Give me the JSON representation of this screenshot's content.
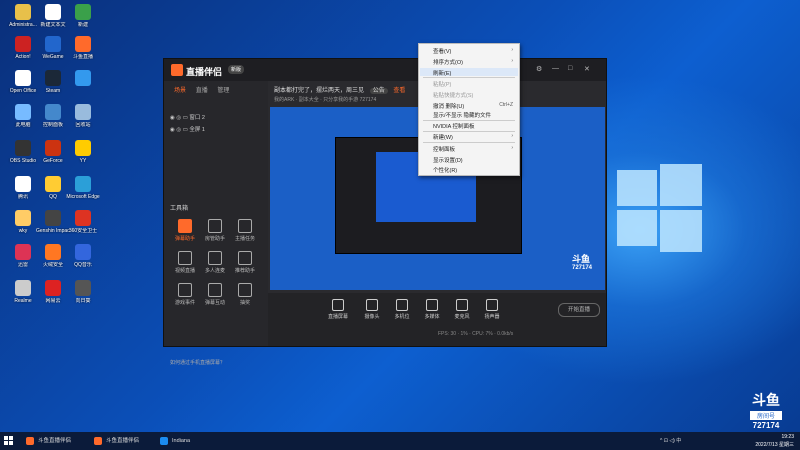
{
  "desktop_icons": [
    {
      "label": "Administra...",
      "color": "#e8c04a"
    },
    {
      "label": "新建文本文",
      "color": "#ffffff"
    },
    {
      "label": "新建",
      "color": "#3aa04a"
    },
    {
      "label": "Action!",
      "color": "#cc2222"
    },
    {
      "label": "WeGame",
      "color": "#2266cc"
    },
    {
      "label": "斗鱼直播",
      "color": "#ff6a2b"
    },
    {
      "label": "Open Office",
      "color": "#ffffff"
    },
    {
      "label": "Steam",
      "color": "#1b2838"
    },
    {
      "label": "",
      "color": "#3399ee"
    },
    {
      "label": "此电脑",
      "color": "#77bbff"
    },
    {
      "label": "控制面板",
      "color": "#4488cc"
    },
    {
      "label": "回收站",
      "color": "#99bbdd"
    },
    {
      "label": "OBS Studio",
      "color": "#333333"
    },
    {
      "label": "GeForce",
      "color": "#cc3311"
    },
    {
      "label": "YY",
      "color": "#ffcc00"
    },
    {
      "label": "腾讯",
      "color": "#ffffff"
    },
    {
      "label": "QQ",
      "color": "#ffcc33"
    },
    {
      "label": "Microsoft Edge",
      "color": "#2b9fd8"
    },
    {
      "label": "wky",
      "color": "#ffcc66"
    },
    {
      "label": "Genshin Impact",
      "color": "#444444"
    },
    {
      "label": "360安全卫士",
      "color": "#dd3322"
    },
    {
      "label": "迅雷",
      "color": "#dd3355"
    },
    {
      "label": "火绒安全",
      "color": "#ff7722"
    },
    {
      "label": "QQ音乐",
      "color": "#3366dd"
    },
    {
      "label": "Realme",
      "color": "#cccccc"
    },
    {
      "label": "网易云",
      "color": "#dd2222"
    },
    {
      "label": "向日葵",
      "color": "#555555"
    }
  ],
  "app": {
    "name": "直播伴侣",
    "version": "新版",
    "win_controls": [
      "⚙",
      "—",
      "□",
      "✕"
    ],
    "tabs": [
      "场景",
      "直播",
      "管理"
    ],
    "scenes": [
      "窗口 2",
      "全屏 1"
    ],
    "tools_title": "工具箱",
    "tools": [
      "弹幕助手",
      "房管助手",
      "主播任务",
      "视频直播",
      "多人连麦",
      "推荐助手",
      "游戏事件",
      "弹幕互动",
      "抽奖"
    ],
    "notice": "副本都打完了，摆烂两天，周三见",
    "notice_tag1": "公告",
    "notice_tag2": "查看",
    "notice_sub": "我的ARK · 副本大全 · 只分享我的手游",
    "room_num": "727174",
    "bottom_buttons": [
      "直播屏幕",
      "摄像头",
      "多机位",
      "多媒体",
      "麦克风",
      "扬声器"
    ],
    "start_live": "开始直播",
    "footer": "如何通过手机直播屏幕？",
    "status": "FPS: 30 · 1% · CPU: 7% · 0.0kb/s"
  },
  "context_menu": {
    "items": [
      {
        "label": "查看(V)",
        "arrow": true,
        "disabled": false
      },
      {
        "label": "排序方式(O)",
        "arrow": true,
        "disabled": false
      },
      {
        "label": "刷新(E)",
        "arrow": false,
        "disabled": false
      },
      {
        "label": "粘贴(P)",
        "arrow": false,
        "disabled": true
      },
      {
        "label": "粘贴快捷方式(S)",
        "arrow": false,
        "disabled": true
      },
      {
        "label": "撤消 删除(U)",
        "arrow": false,
        "disabled": false,
        "shortcut": "Ctrl+Z"
      },
      {
        "label": "显示/不显示 隐藏的文件",
        "arrow": false,
        "disabled": false
      },
      {
        "label": "NVIDIA 控制面板",
        "arrow": false,
        "disabled": false
      },
      {
        "label": "新建(W)",
        "arrow": true,
        "disabled": false
      },
      {
        "label": "控制面板",
        "arrow": true,
        "disabled": false
      },
      {
        "label": "显示设置(D)",
        "arrow": false,
        "disabled": false
      },
      {
        "label": "个性化(R)",
        "arrow": false,
        "disabled": false
      }
    ]
  },
  "watermark": {
    "logo": "斗鱼",
    "room_label": "房间号",
    "room_number": "727174"
  },
  "taskbar": {
    "items": [
      {
        "label": "斗鱼直播伴侣",
        "color": "#ff6a2b"
      },
      {
        "label": "斗鱼直播伴侣",
        "color": "#ff6a2b"
      },
      {
        "label": "Indiana",
        "color": "#1b8cf0"
      }
    ],
    "tray": "^  ⊡  ◁)  中",
    "time": "19:23",
    "date": "2022/7/13 星期三"
  },
  "colors": {
    "accent": "#ff6a2b",
    "desktop_blue": "#0b4fb8"
  }
}
